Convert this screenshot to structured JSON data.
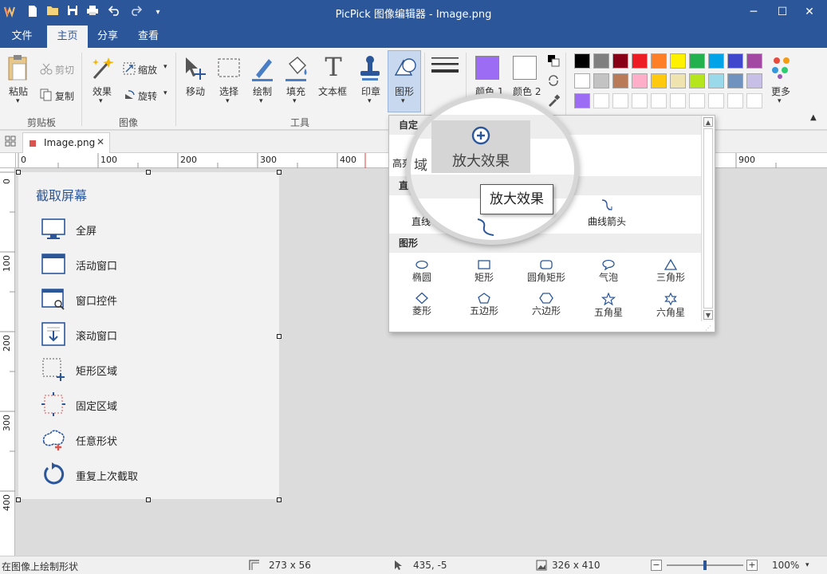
{
  "window": {
    "title": "PicPick 图像编辑器 - Image.png",
    "quick_access_icons": [
      "app-logo-icon",
      "new-icon",
      "open-icon",
      "save-icon",
      "print-icon",
      "undo-icon",
      "redo-icon",
      "customize-icon"
    ],
    "controls": {
      "minimize": "─",
      "maximize": "☐",
      "close": "✕"
    }
  },
  "menu": {
    "tabs": [
      {
        "label": "文件",
        "active": false
      },
      {
        "label": "主页",
        "active": true
      },
      {
        "label": "分享",
        "active": false
      },
      {
        "label": "查看",
        "active": false
      }
    ]
  },
  "ribbon": {
    "clipboard": {
      "group_label": "剪贴板",
      "paste": "粘贴",
      "cut": "剪切",
      "copy": "复制"
    },
    "image": {
      "group_label": "图像",
      "effects": "效果",
      "resize": "缩放",
      "rotate": "旋转"
    },
    "tools": {
      "group_label": "工具",
      "move": "移动",
      "select": "选择",
      "draw": "绘制",
      "fill": "填充",
      "text": "文本框",
      "stamp": "印章",
      "shape": "图形"
    },
    "color1_label": "颜色 1",
    "color2_label": "颜色 2",
    "color1": "#9c6cf5",
    "color2": "#ffffff",
    "more_label": "更多",
    "palette_row1": [
      "#000000",
      "#7f7f7f",
      "#880015",
      "#ed1c24",
      "#ff7f27",
      "#fff200",
      "#22b14c",
      "#00a2e8",
      "#3f48cc",
      "#a349a4"
    ],
    "palette_row2": [
      "#ffffff",
      "#c3c3c3",
      "#b97a57",
      "#ffaec9",
      "#ffc90e",
      "#efe4b0",
      "#b5e61d",
      "#99d9ea",
      "#7092be",
      "#c8bfe7"
    ],
    "palette_row3": [
      "#9c6cf5",
      "#ffffff",
      "#ffffff",
      "#ffffff",
      "#ffffff",
      "#ffffff",
      "#ffffff",
      "#ffffff",
      "#ffffff",
      "#ffffff"
    ]
  },
  "document_tab": {
    "name": "Image.png",
    "close": "✕"
  },
  "ruler": {
    "h_labels": [
      "0",
      "100",
      "200",
      "300",
      "400",
      "900"
    ],
    "v_labels": [
      "0",
      "100",
      "200",
      "300",
      "400"
    ]
  },
  "capture_panel": {
    "title": "截取屏幕",
    "items": [
      {
        "label": "全屏",
        "icon": "monitor-icon"
      },
      {
        "label": "活动窗口",
        "icon": "window-icon"
      },
      {
        "label": "窗口控件",
        "icon": "window-control-icon"
      },
      {
        "label": "滚动窗口",
        "icon": "scroll-window-icon"
      },
      {
        "label": "矩形区域",
        "icon": "rect-region-icon"
      },
      {
        "label": "固定区域",
        "icon": "fixed-region-icon"
      },
      {
        "label": "任意形状",
        "icon": "freeform-icon"
      },
      {
        "label": "重复上次截取",
        "icon": "repeat-capture-icon"
      }
    ]
  },
  "shape_dropdown": {
    "section_custom": "自定",
    "highlight_label": "高亮",
    "section_lines": "直",
    "line_label": "直线",
    "curve_arrow_label": "曲线箭头",
    "section_shapes": "图形",
    "shapes": [
      {
        "label": "椭圆",
        "icon": "ellipse-icon"
      },
      {
        "label": "矩形",
        "icon": "rectangle-icon"
      },
      {
        "label": "圆角矩形",
        "icon": "rounded-rect-icon"
      },
      {
        "label": "气泡",
        "icon": "bubble-icon"
      },
      {
        "label": "三角形",
        "icon": "triangle-icon"
      },
      {
        "label": "菱形",
        "icon": "diamond-icon"
      },
      {
        "label": "五边形",
        "icon": "pentagon-icon"
      },
      {
        "label": "六边形",
        "icon": "hexagon-icon"
      },
      {
        "label": "五角星",
        "icon": "star5-icon"
      },
      {
        "label": "六角星",
        "icon": "star6-icon"
      }
    ]
  },
  "magnifier": {
    "region_text": "域",
    "zoom_label": "放大效果"
  },
  "tooltip": {
    "text": "放大效果"
  },
  "status": {
    "message": "在图像上绘制形状",
    "selection_size": "273 x 56",
    "cursor_pos": "435, -5",
    "image_size": "326 x 410",
    "zoom": "100%",
    "zoom_fraction": 0.5
  }
}
